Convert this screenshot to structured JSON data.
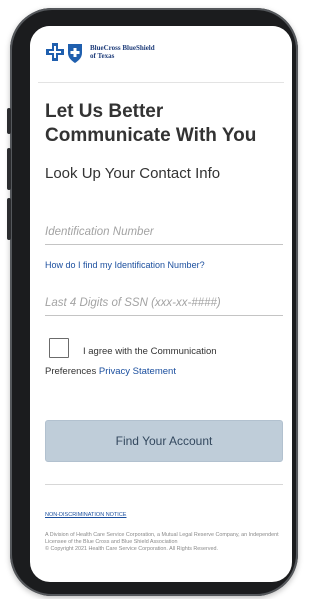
{
  "brand": {
    "name_line1": "BlueCross BlueShield",
    "name_line2": "of Texas",
    "colors": {
      "primary": "#1f5fae",
      "text_dark": "#333333",
      "link": "#1a4e9e",
      "button_disabled": "#bfcdd9"
    },
    "icons": [
      "blue-cross-icon",
      "blue-shield-icon"
    ]
  },
  "page": {
    "title_line1": "Let Us Better",
    "title_line2": "Communicate With You",
    "section_title": "Look Up Your Contact Info"
  },
  "form": {
    "id_field": {
      "placeholder": "Identification Number",
      "value": ""
    },
    "id_help_link": "How do I find my Identification Number?",
    "ssn_field": {
      "placeholder": "Last 4 Digits of SSN (xxx-xx-####)",
      "value": ""
    },
    "agree_checkbox": {
      "checked": false
    },
    "agree_text_line1": "I agree with the Communication",
    "agree_text_prefix": "Preferences ",
    "privacy_link": "Privacy Statement",
    "submit_label": "Find Your Account"
  },
  "footer": {
    "notice_link": "NON-DISCRIMINATION NOTICE",
    "legal": "A Division of Health Care Service Corporation, a Mutual Legal Reserve Company, an Independent Licensee of the Blue Cross and Blue Shield Association",
    "copyright": "© Copyright 2021 Health Care Service Corporation. All Rights Reserved."
  }
}
